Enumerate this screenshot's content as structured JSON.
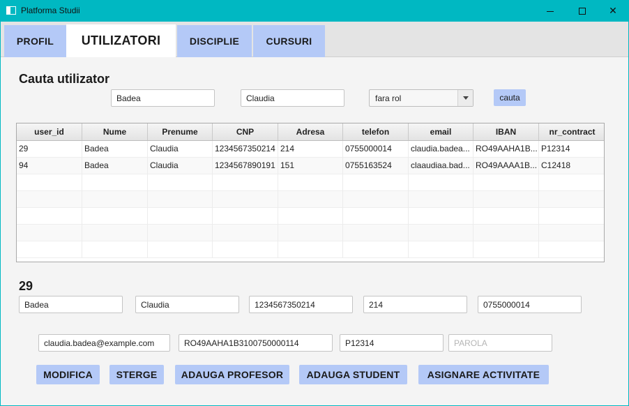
{
  "window": {
    "title": "Platforma Studii",
    "icon": "app-window-icon"
  },
  "tabs": [
    {
      "label": "PROFIL",
      "active": false
    },
    {
      "label": "UTILIZATORI",
      "active": true
    },
    {
      "label": "DISCIPLIE",
      "active": false
    },
    {
      "label": "CURSURI",
      "active": false
    }
  ],
  "search": {
    "heading": "Cauta utilizator",
    "nume_value": "Badea",
    "prenume_value": "Claudia",
    "rol_selected": "fara rol",
    "button_label": "cauta"
  },
  "table": {
    "columns": [
      "user_id",
      "Nume",
      "Prenume",
      "CNP",
      "Adresa",
      "telefon",
      "email",
      "IBAN",
      "nr_contract"
    ],
    "rows": [
      [
        "29",
        "Badea",
        "Claudia",
        "1234567350214",
        "214",
        "0755000014",
        "claudia.badea...",
        "RO49AAHA1B...",
        "P12314"
      ],
      [
        "94",
        "Badea",
        "Claudia",
        "1234567890191",
        "151",
        "0755163524",
        "claaudiaa.bad...",
        "RO49AAAA1B...",
        "C12418"
      ]
    ]
  },
  "details": {
    "selected_id": "29",
    "nume": "Badea",
    "prenume": "Claudia",
    "cnp": "1234567350214",
    "adresa": "214",
    "telefon": "0755000014",
    "email": "claudia.badea@example.com",
    "iban": "RO49AAHA1B3100750000114",
    "nr_contract": "P12314",
    "parola_value": "",
    "parola_placeholder": "PAROLA"
  },
  "actions": {
    "modifica": "MODIFICA",
    "sterge": "STERGE",
    "adauga_profesor": "ADAUGA PROFESOR",
    "adauga_student": "ADAUGA STUDENT",
    "asignare_activitate": "ASIGNARE ACTIVITATE"
  },
  "colors": {
    "titlebar": "#00b8c2",
    "accent_button": "#b4c9f7",
    "background": "#f4f4f4"
  }
}
